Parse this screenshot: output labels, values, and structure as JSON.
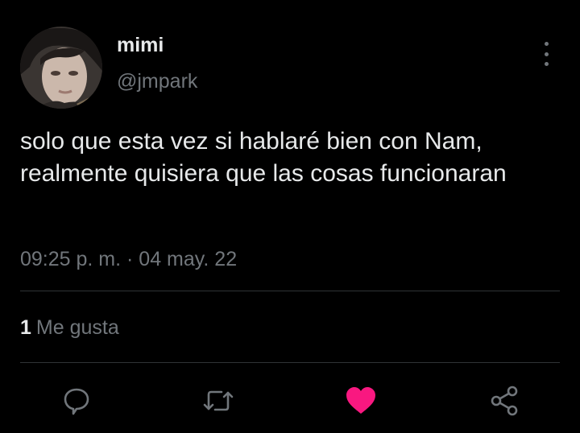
{
  "user": {
    "display_name": "mimi",
    "handle": "@jmpark"
  },
  "tweet": {
    "text": "solo que esta vez si hablaré bien con Nam, realmente quisiera que las cosas funcionaran",
    "timestamp": "09:25 p. m. · 04 may. 22"
  },
  "stats": {
    "like_count": "1",
    "like_label": "Me gusta"
  },
  "actions": [
    "reply-icon",
    "retweet-icon",
    "like-icon",
    "share-icon"
  ],
  "colors": {
    "background": "#000000",
    "primary_text": "#e7e9ea",
    "secondary_text": "#71767b",
    "like_active": "#f91880",
    "divider": "#2f3336"
  }
}
